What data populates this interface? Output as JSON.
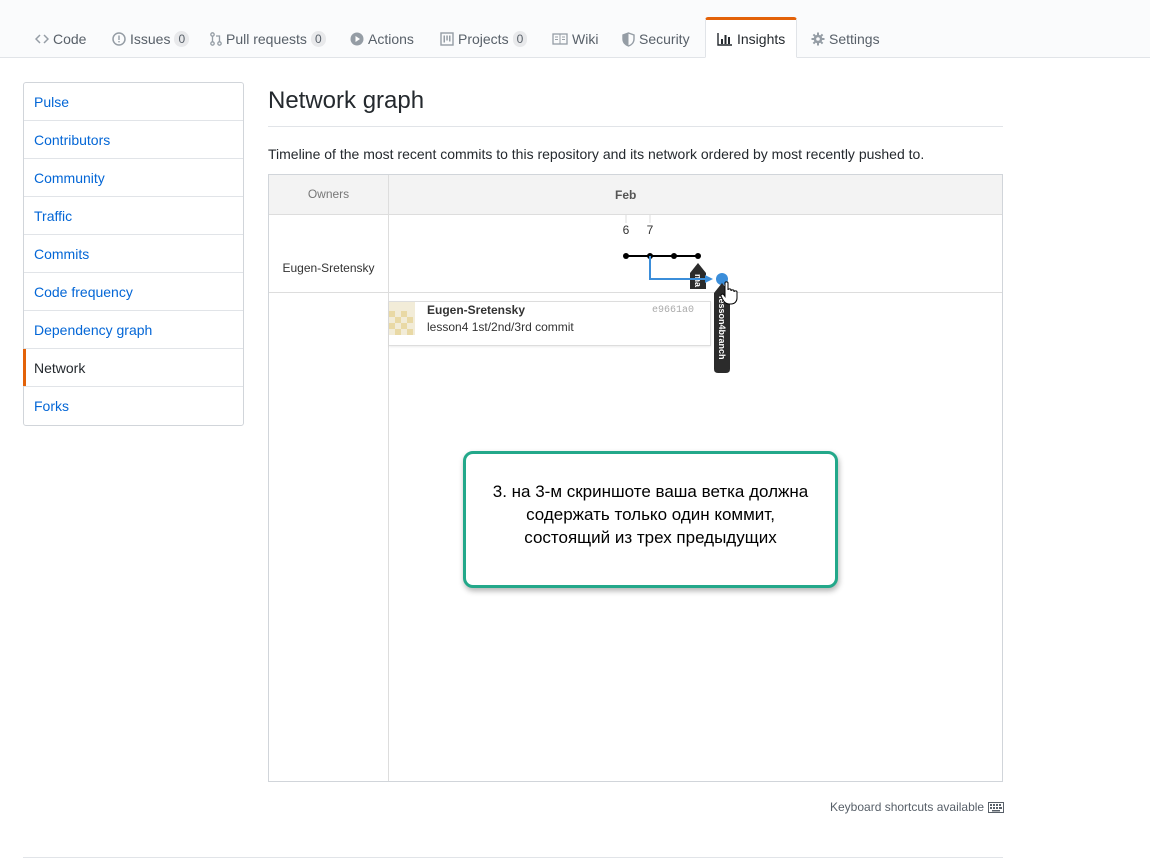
{
  "repo_nav": {
    "tabs": [
      {
        "label": "Code",
        "icon": "code-icon"
      },
      {
        "label": "Issues",
        "icon": "issue-opened-icon",
        "count": "0"
      },
      {
        "label": "Pull requests",
        "icon": "git-pull-request-icon",
        "count": "0"
      },
      {
        "label": "Actions",
        "icon": "play-icon"
      },
      {
        "label": "Projects",
        "icon": "project-icon",
        "count": "0"
      },
      {
        "label": "Wiki",
        "icon": "book-icon"
      },
      {
        "label": "Security",
        "icon": "shield-icon"
      },
      {
        "label": "Insights",
        "icon": "graph-icon",
        "selected": true
      },
      {
        "label": "Settings",
        "icon": "gear-icon"
      }
    ]
  },
  "sidebar": {
    "items": [
      {
        "label": "Pulse"
      },
      {
        "label": "Contributors"
      },
      {
        "label": "Community"
      },
      {
        "label": "Traffic"
      },
      {
        "label": "Commits"
      },
      {
        "label": "Code frequency"
      },
      {
        "label": "Dependency graph"
      },
      {
        "label": "Network",
        "selected": true
      },
      {
        "label": "Forks"
      }
    ]
  },
  "main": {
    "title": "Network graph",
    "description": "Timeline of the most recent commits to this repository and its network ordered by most recently pushed to."
  },
  "network": {
    "owners_header": "Owners",
    "month": "Feb",
    "days": [
      "6",
      "7"
    ],
    "owner": "Eugen-Sretensky",
    "branches": [
      "ma",
      "lesson4branch"
    ],
    "colors": {
      "master_line": "#000000",
      "branch_line": "#3b8eda",
      "label_bg": "#2b2b2b"
    },
    "commit_card": {
      "author": "Eugen-Sretensky",
      "message": "lesson4 1st/2nd/3rd commit",
      "sha": "e9661a0"
    }
  },
  "annotation": {
    "text": "3. на 3-м скриншоте ваша ветка должна\nсодержать только один коммит,\nсостоящий из трех предыдущих",
    "border_color": "#23a88a"
  },
  "footer": {
    "keyboard_hint": "Keyboard shortcuts available"
  }
}
